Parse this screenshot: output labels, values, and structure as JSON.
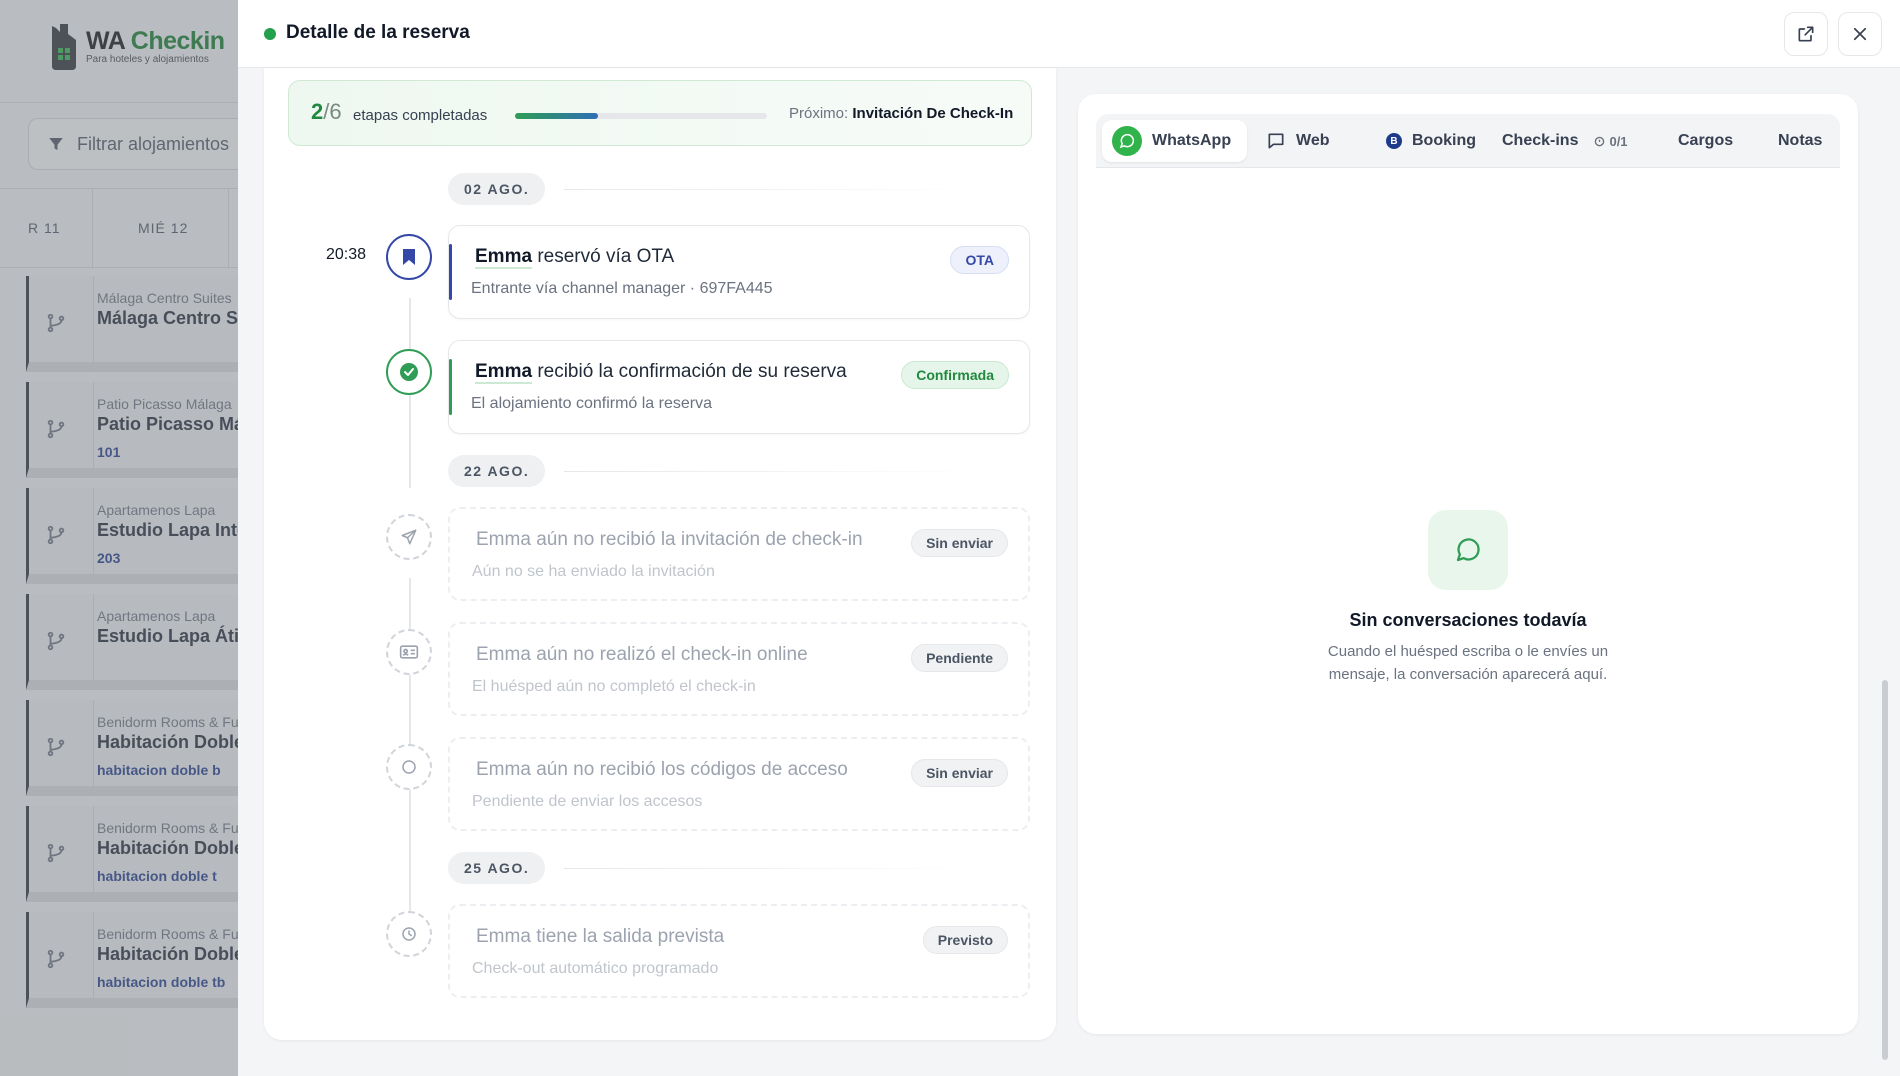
{
  "background": {
    "brand_name_a": "WA",
    "brand_name_b": "Checkin",
    "brand_sub": "Para hoteles y alojamientos",
    "filter_placeholder": "Filtrar alojamientos",
    "cal_col_1": "R 11",
    "cal_col_2": "MIÉ 12",
    "rows": [
      {
        "group": "Málaga Centro Suites",
        "name": "Málaga Centro Su",
        "unit": ""
      },
      {
        "group": "Patio Picasso Málaga",
        "name": "Patio Picasso Má",
        "unit": "101"
      },
      {
        "group": "Apartamenos Lapa",
        "name": "Estudio Lapa Inte",
        "unit": "203"
      },
      {
        "group": "Apartamenos Lapa",
        "name": "Estudio Lapa Átic",
        "unit": ""
      },
      {
        "group": "Benidorm Rooms & Fu",
        "name": "Habitación Doble",
        "unit": "habitacion doble b"
      },
      {
        "group": "Benidorm Rooms & Fu",
        "name": "Habitación Doble",
        "unit": "habitacion doble t"
      },
      {
        "group": "Benidorm Rooms & Fu",
        "name": "Habitación Doble",
        "unit": "habitacion doble tb"
      }
    ]
  },
  "header": {
    "title": "Detalle de la reserva",
    "status_color": "#22a04b"
  },
  "progress": {
    "done": "2",
    "total": "/6",
    "label": "etapas completadas",
    "fraction": 0.33,
    "next_label": "Próximo:",
    "next_value": "Invitación De Check-In"
  },
  "timeline": {
    "dates": [
      "02 AGO.",
      "22 AGO.",
      "25 AGO."
    ],
    "time_first": "20:38",
    "events": [
      {
        "name": "Emma",
        "action": "reservó vía OTA",
        "sub": "Entrante vía channel manager · 697FA445",
        "badge": "OTA",
        "state": "active",
        "accent": "#3548a8",
        "icon": "bookmark-icon"
      },
      {
        "name": "Emma",
        "action": "recibió la confirmación de su reserva",
        "sub": "El alojamiento confirmó la reserva",
        "badge": "Confirmada",
        "state": "active",
        "accent": "#2f9d55",
        "icon": "check-circle-icon"
      },
      {
        "name": "Emma",
        "action": "aún no recibió la invitación de check-in",
        "sub": "Aún no se ha enviado la invitación",
        "badge": "Sin enviar",
        "state": "pending",
        "icon": "send-icon"
      },
      {
        "name": "Emma",
        "action": "aún no realizó el check-in online",
        "sub": "El huésped aún no completó el check-in",
        "badge": "Pendiente",
        "state": "pending",
        "icon": "id-card-icon"
      },
      {
        "name": "Emma",
        "action": "aún no recibió los códigos de acceso",
        "sub": "Pendiente de enviar los accesos",
        "badge": "Sin enviar",
        "state": "pending",
        "icon": "circle-icon"
      },
      {
        "name": "Emma",
        "action": "tiene la salida prevista",
        "sub": "Check-out automático programado",
        "badge": "Previsto",
        "state": "pending",
        "icon": "clock-icon"
      }
    ]
  },
  "tabs": {
    "whatsapp": "WhatsApp",
    "web": "Web",
    "booking": "Booking",
    "booking_letter": "B",
    "checkins": "Check-ins",
    "checkins_count": "0/1",
    "cargos": "Cargos",
    "notas": "Notas"
  },
  "empty_state": {
    "title": "Sin conversaciones todavía",
    "text": "Cuando el huésped escriba o le envíes un mensaje, la conversación aparecerá aquí."
  }
}
